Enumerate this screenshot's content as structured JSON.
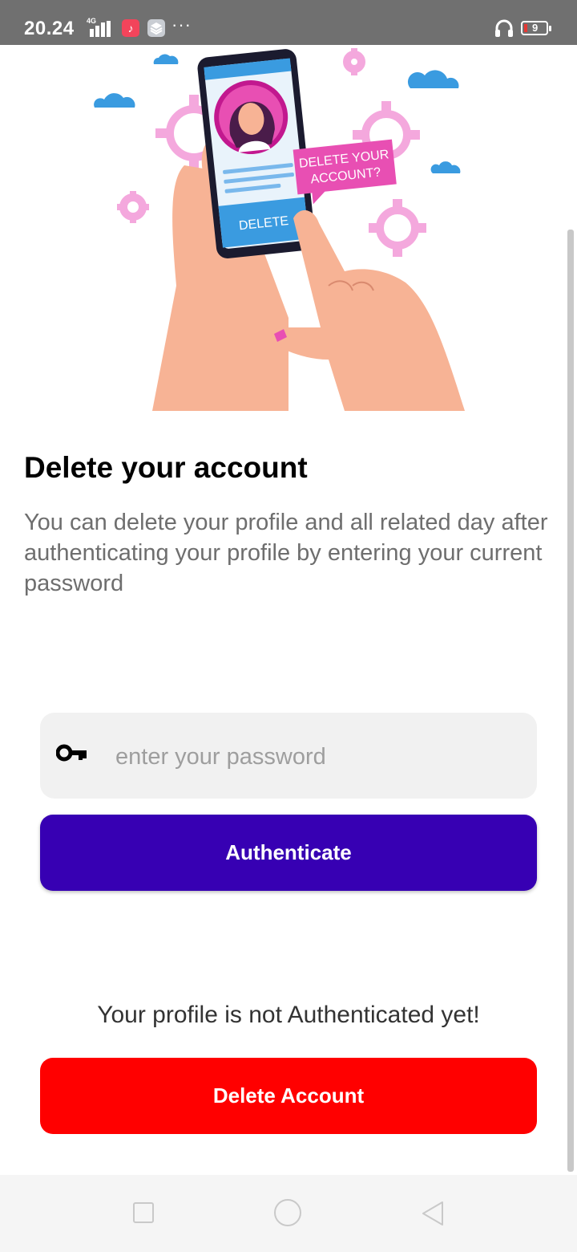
{
  "status_bar": {
    "time": "20.24",
    "network": "4G",
    "battery_level": "9",
    "more": "···",
    "music_icon": "music-note-icon",
    "stack_icon": "stack-icon",
    "headset_icon": "headset-icon"
  },
  "illustration": {
    "bubble_line1": "DELETE YOUR",
    "bubble_line2": "ACCOUNT?",
    "phone_button": "DELETE"
  },
  "page": {
    "title": "Delete your account",
    "description": "You can delete your profile and all related day after authenticating your profile by entering your current password"
  },
  "password": {
    "placeholder": "enter your password",
    "icon": "key-icon"
  },
  "buttons": {
    "authenticate": "Authenticate",
    "delete_account": "Delete Account"
  },
  "auth_status": "Your profile is not Authenticated yet!",
  "colors": {
    "primary": "#3700B3",
    "danger": "#FF0000",
    "status_bar": "#707070",
    "input_bg": "#F1F1F1"
  }
}
